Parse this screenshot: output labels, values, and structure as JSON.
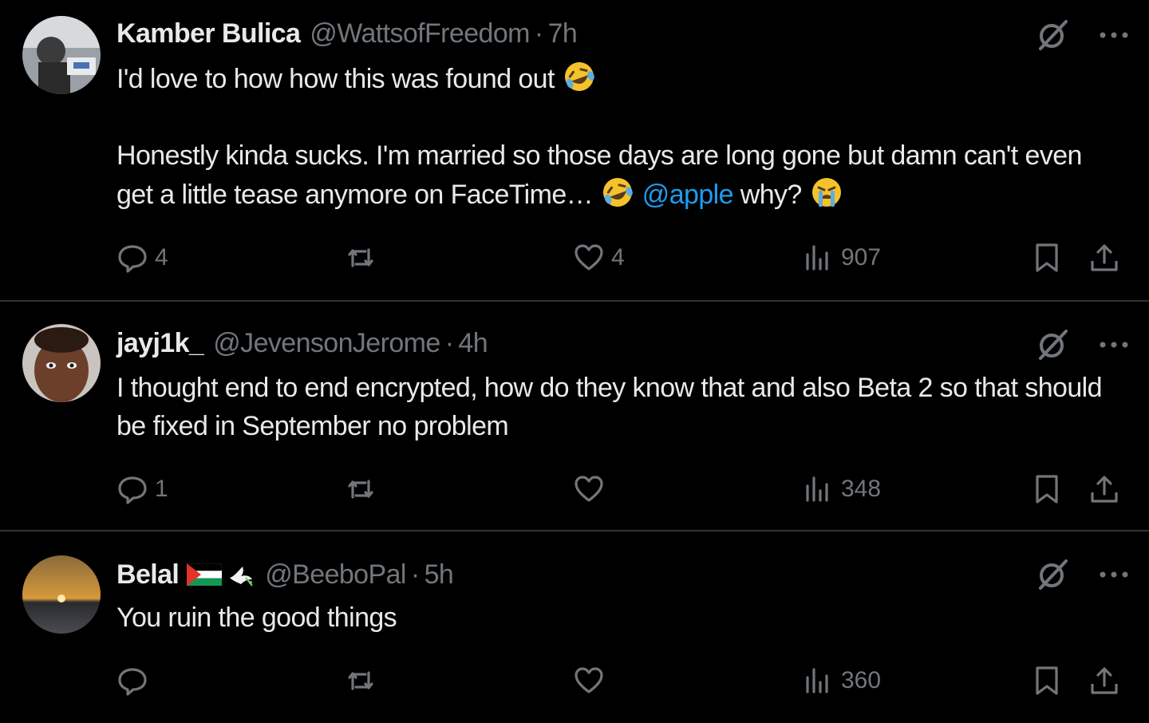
{
  "posts": [
    {
      "name": "Kamber Bulica",
      "handle": "@WattsofFreedom",
      "separator": "·",
      "time": "7h",
      "text_line1": "I'd love to how how this was found out",
      "text_para2_a": "Honestly kinda sucks. I'm married so those days are long gone but damn can't even get a little tease anymore on FaceTime…",
      "mention": "@apple",
      "text_para2_b": "why?",
      "replies": "4",
      "reposts": "",
      "likes": "4",
      "views": "907"
    },
    {
      "name": "jayj1k_",
      "handle": "@JevensonJerome",
      "separator": "·",
      "time": "4h",
      "text": "I thought end to end encrypted, how do they know that and also Beta 2 so that should be fixed in September no problem",
      "replies": "1",
      "reposts": "",
      "likes": "",
      "views": "348"
    },
    {
      "name": "Belal",
      "handle": "@BeeboPal",
      "separator": "·",
      "time": "5h",
      "text": "You ruin the good things",
      "replies": "",
      "reposts": "",
      "likes": "",
      "views": "360"
    }
  ],
  "icons": {
    "reply": "reply-bubble-icon",
    "repost": "repost-arrows-icon",
    "like": "heart-icon",
    "views": "analytics-bars-icon",
    "bookmark": "bookmark-icon",
    "share": "share-upload-icon",
    "grok": "grok-slash-circle-icon",
    "more": "more-dots-icon"
  },
  "colors": {
    "background": "#000000",
    "text": "#e7e9ea",
    "muted": "#71767b",
    "link": "#1d9bf0",
    "divider": "#2f3336"
  }
}
